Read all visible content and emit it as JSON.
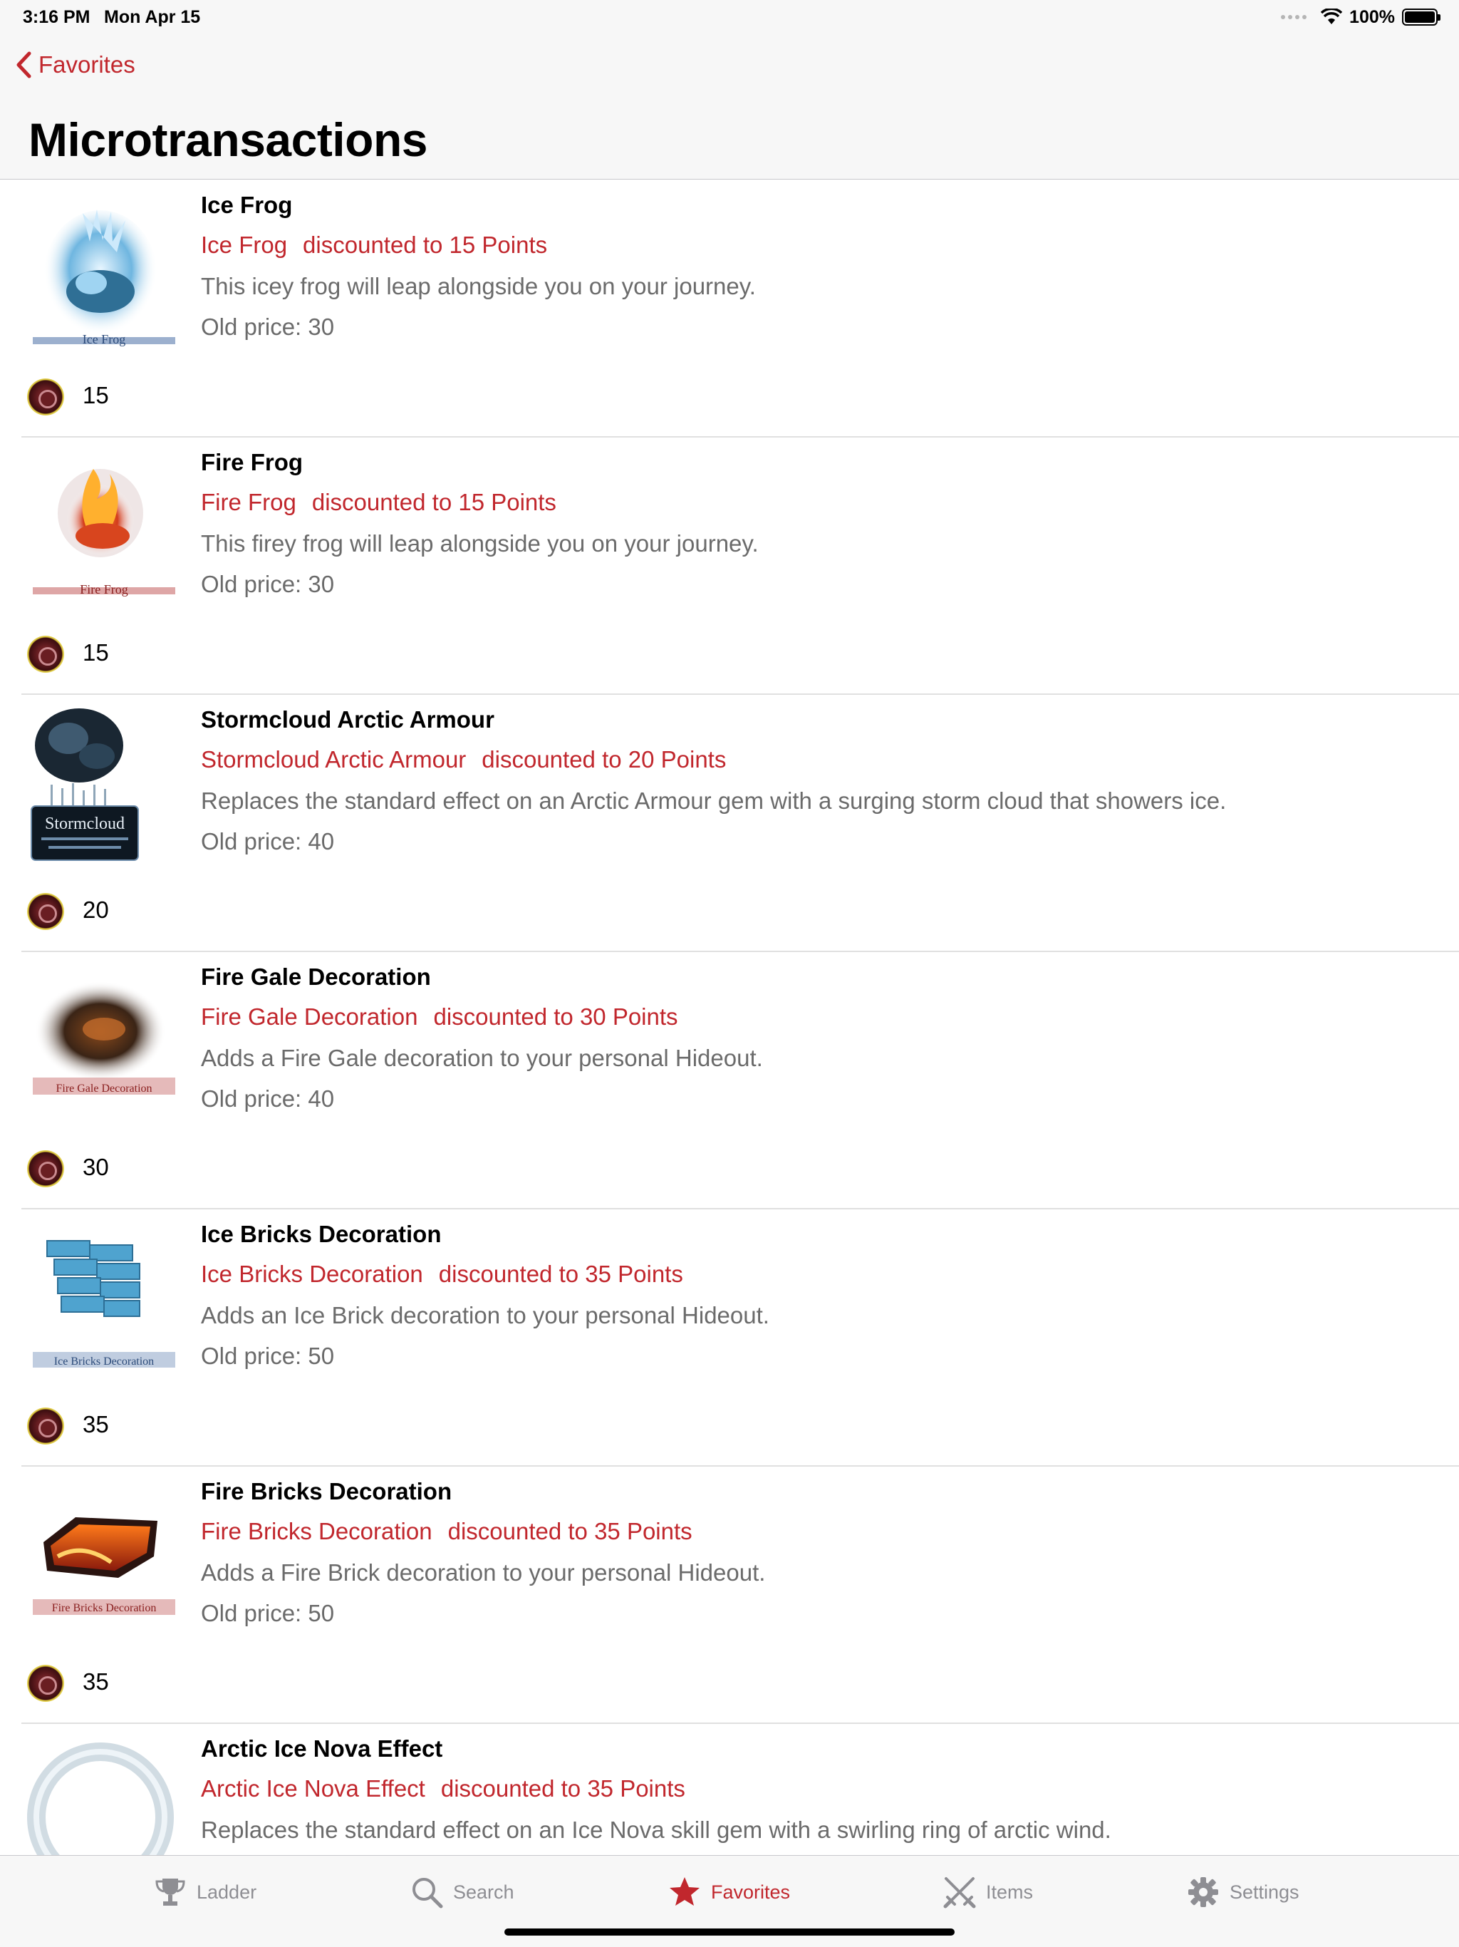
{
  "status": {
    "time": "3:16 PM",
    "date": "Mon Apr 15",
    "battery": "100%",
    "battery_level": 1.0
  },
  "nav": {
    "back_label": "Favorites",
    "title": "Microtransactions"
  },
  "items": [
    {
      "title": "Ice Frog",
      "sub_name": "Ice Frog",
      "discount": "discounted to 15 Points",
      "description": "This icey frog will leap alongside you on your journey.",
      "old_price": "Old price: 30",
      "price": "15",
      "thumb_caption": "Ice Frog",
      "thumb_icon": "ice-frog-image"
    },
    {
      "title": "Fire Frog",
      "sub_name": "Fire Frog",
      "discount": "discounted to 15 Points",
      "description": "This firey frog will leap alongside you on your journey.",
      "old_price": "Old price: 30",
      "price": "15",
      "thumb_caption": "Fire Frog",
      "thumb_icon": "fire-frog-image"
    },
    {
      "title": "Stormcloud Arctic Armour",
      "sub_name": "Stormcloud Arctic Armour",
      "discount": "discounted to 20 Points",
      "description": "Replaces the standard effect on an Arctic Armour gem with a surging storm cloud that showers ice.",
      "old_price": "Old price: 40",
      "price": "20",
      "thumb_caption": "Stormcloud",
      "thumb_icon": "stormcloud-image"
    },
    {
      "title": "Fire Gale Decoration",
      "sub_name": "Fire Gale Decoration",
      "discount": "discounted to 30 Points",
      "description": "Adds a Fire Gale decoration to your personal Hideout.",
      "old_price": "Old price: 40",
      "price": "30",
      "thumb_caption": "Fire Gale Decoration",
      "thumb_icon": "fire-gale-image"
    },
    {
      "title": "Ice Bricks Decoration",
      "sub_name": "Ice Bricks Decoration",
      "discount": "discounted to 35 Points",
      "description": "Adds an Ice Brick decoration to your personal Hideout.",
      "old_price": "Old price: 50",
      "price": "35",
      "thumb_caption": "Ice Bricks Decoration",
      "thumb_icon": "ice-bricks-image"
    },
    {
      "title": "Fire Bricks Decoration",
      "sub_name": "Fire Bricks Decoration",
      "discount": "discounted to 35 Points",
      "description": "Adds a Fire Brick decoration to your personal Hideout.",
      "old_price": "Old price: 50",
      "price": "35",
      "thumb_caption": "Fire Bricks Decoration",
      "thumb_icon": "fire-bricks-image"
    },
    {
      "title": "Arctic Ice Nova Effect",
      "sub_name": "Arctic Ice Nova Effect",
      "discount": "discounted to 35 Points",
      "description": "Replaces the standard effect on an Ice Nova skill gem with a swirling ring of arctic wind.",
      "old_price": "",
      "price": "",
      "thumb_caption": "",
      "thumb_icon": "ice-nova-image"
    }
  ],
  "tabs": [
    {
      "label": "Ladder",
      "icon": "trophy-icon",
      "active": false
    },
    {
      "label": "Search",
      "icon": "search-icon",
      "active": false
    },
    {
      "label": "Favorites",
      "icon": "star-icon",
      "active": true
    },
    {
      "label": "Items",
      "icon": "crossed-swords-icon",
      "active": false
    },
    {
      "label": "Settings",
      "icon": "gear-icon",
      "active": false
    }
  ],
  "colors": {
    "accent": "#c1272d",
    "secondary_text": "#6b6b6b",
    "inactive_tab": "#8e8e93",
    "bar_background": "#f7f7f7"
  }
}
